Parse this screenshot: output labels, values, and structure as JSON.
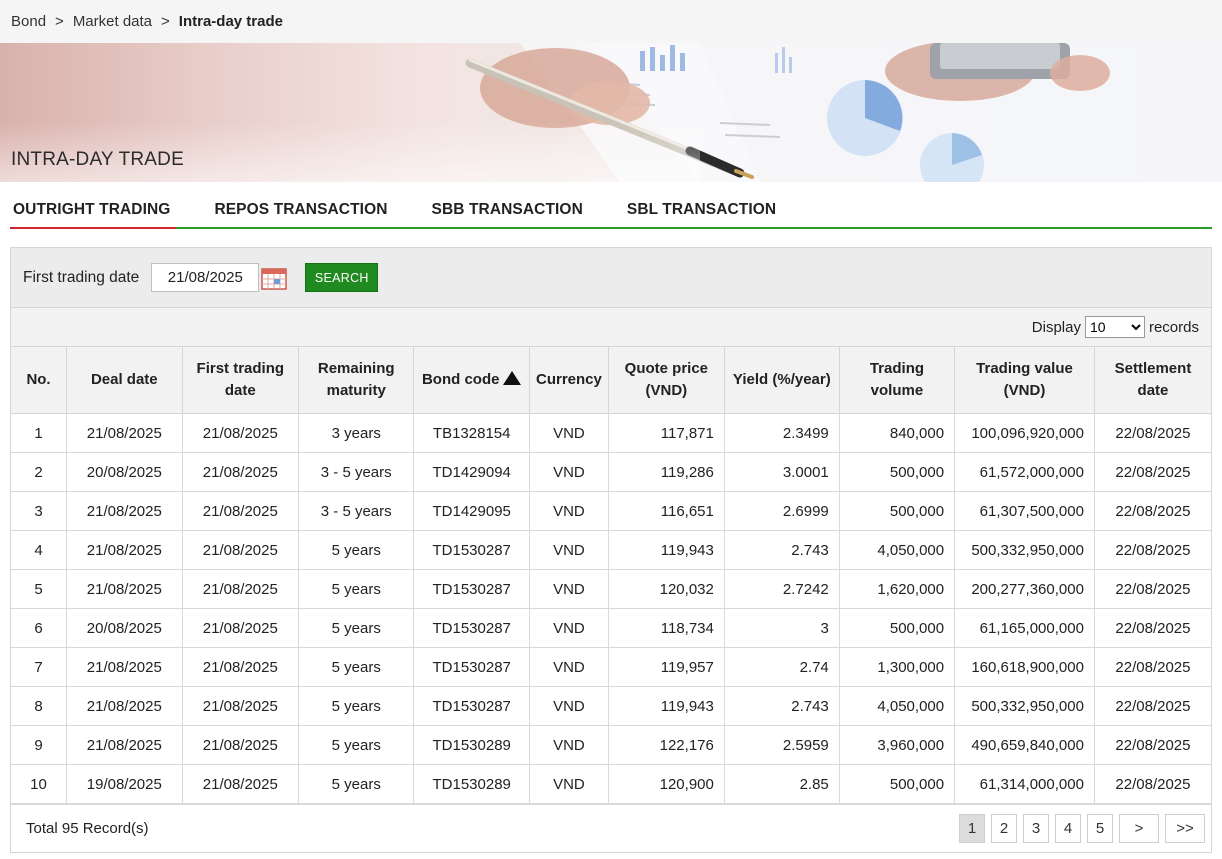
{
  "breadcrumb": {
    "items": [
      "Bond",
      "Market data"
    ],
    "separator": ">",
    "current": "Intra-day trade"
  },
  "banner": {
    "title": "INTRA-DAY TRADE"
  },
  "tabs": [
    {
      "label": "OUTRIGHT TRADING",
      "active": true
    },
    {
      "label": "REPOS TRANSACTION",
      "active": false
    },
    {
      "label": "SBB TRANSACTION",
      "active": false
    },
    {
      "label": "SBL TRANSACTION",
      "active": false
    }
  ],
  "filter": {
    "label": "First trading date",
    "date_value": "21/08/2025",
    "search_label": "SEARCH"
  },
  "display": {
    "prefix": "Display",
    "selected": "10",
    "suffix": "records"
  },
  "table": {
    "headers": {
      "no": "No.",
      "deal_date": "Deal date",
      "first_trading_1": "First trading",
      "first_trading_2": "date",
      "remaining_1": "Remaining",
      "remaining_2": "maturity",
      "bond_code": "Bond code",
      "currency": "Currency",
      "quote_1": "Quote price",
      "quote_2": "(VND)",
      "yield": "Yield (%/year)",
      "volume_1": "Trading",
      "volume_2": "volume",
      "value_1": "Trading value",
      "value_2": "(VND)",
      "settlement_1": "Settlement",
      "settlement_2": "date"
    },
    "rows": [
      {
        "no": "1",
        "deal_date": "21/08/2025",
        "first_trading_date": "21/08/2025",
        "maturity": "3 years",
        "code": "TB1328154",
        "currency": "VND",
        "price": "117,871",
        "yield": "2.3499",
        "volume": "840,000",
        "value": "100,096,920,000",
        "settlement": "22/08/2025"
      },
      {
        "no": "2",
        "deal_date": "20/08/2025",
        "first_trading_date": "21/08/2025",
        "maturity": "3 - 5 years",
        "code": "TD1429094",
        "currency": "VND",
        "price": "119,286",
        "yield": "3.0001",
        "volume": "500,000",
        "value": "61,572,000,000",
        "settlement": "22/08/2025"
      },
      {
        "no": "3",
        "deal_date": "21/08/2025",
        "first_trading_date": "21/08/2025",
        "maturity": "3 - 5 years",
        "code": "TD1429095",
        "currency": "VND",
        "price": "116,651",
        "yield": "2.6999",
        "volume": "500,000",
        "value": "61,307,500,000",
        "settlement": "22/08/2025"
      },
      {
        "no": "4",
        "deal_date": "21/08/2025",
        "first_trading_date": "21/08/2025",
        "maturity": "5 years",
        "code": "TD1530287",
        "currency": "VND",
        "price": "119,943",
        "yield": "2.743",
        "volume": "4,050,000",
        "value": "500,332,950,000",
        "settlement": "22/08/2025"
      },
      {
        "no": "5",
        "deal_date": "21/08/2025",
        "first_trading_date": "21/08/2025",
        "maturity": "5 years",
        "code": "TD1530287",
        "currency": "VND",
        "price": "120,032",
        "yield": "2.7242",
        "volume": "1,620,000",
        "value": "200,277,360,000",
        "settlement": "22/08/2025"
      },
      {
        "no": "6",
        "deal_date": "20/08/2025",
        "first_trading_date": "21/08/2025",
        "maturity": "5 years",
        "code": "TD1530287",
        "currency": "VND",
        "price": "118,734",
        "yield": "3",
        "volume": "500,000",
        "value": "61,165,000,000",
        "settlement": "22/08/2025"
      },
      {
        "no": "7",
        "deal_date": "21/08/2025",
        "first_trading_date": "21/08/2025",
        "maturity": "5 years",
        "code": "TD1530287",
        "currency": "VND",
        "price": "119,957",
        "yield": "2.74",
        "volume": "1,300,000",
        "value": "160,618,900,000",
        "settlement": "22/08/2025"
      },
      {
        "no": "8",
        "deal_date": "21/08/2025",
        "first_trading_date": "21/08/2025",
        "maturity": "5 years",
        "code": "TD1530287",
        "currency": "VND",
        "price": "119,943",
        "yield": "2.743",
        "volume": "4,050,000",
        "value": "500,332,950,000",
        "settlement": "22/08/2025"
      },
      {
        "no": "9",
        "deal_date": "21/08/2025",
        "first_trading_date": "21/08/2025",
        "maturity": "5 years",
        "code": "TD1530289",
        "currency": "VND",
        "price": "122,176",
        "yield": "2.5959",
        "volume": "3,960,000",
        "value": "490,659,840,000",
        "settlement": "22/08/2025"
      },
      {
        "no": "10",
        "deal_date": "19/08/2025",
        "first_trading_date": "21/08/2025",
        "maturity": "5 years",
        "code": "TD1530289",
        "currency": "VND",
        "price": "120,900",
        "yield": "2.85",
        "volume": "500,000",
        "value": "61,314,000,000",
        "settlement": "22/08/2025"
      }
    ]
  },
  "footer": {
    "total": "Total 95 Record(s)",
    "pages": [
      "1",
      "2",
      "3",
      "4",
      "5"
    ],
    "next": ">",
    "last": ">>"
  },
  "icons": {
    "calendar": "calendar-icon",
    "sort": "sort-ascending-icon",
    "select_arrow": "chevron-down-icon"
  },
  "colors": {
    "tab_underline": "#2a9a2a",
    "active_tab": "#d0262b",
    "search_button": "#1f8a1f"
  }
}
